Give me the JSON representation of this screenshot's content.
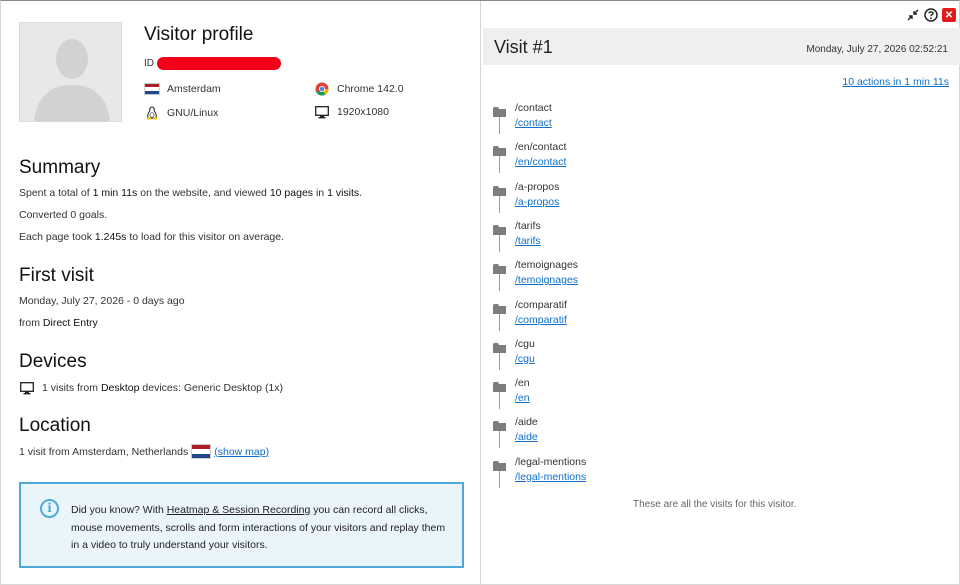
{
  "profile": {
    "title": "Visitor profile",
    "id_label": "ID",
    "city": "Amsterdam",
    "os": "GNU/Linux",
    "browser": "Chrome 142.0",
    "resolution": "1920x1080",
    "flag_colors": [
      "#ae1c28",
      "#ffffff",
      "#21468b"
    ]
  },
  "summary": {
    "heading": "Summary",
    "line1_a": "Spent a total of ",
    "line1_b": "1 min 11s",
    "line1_c": " on the website, and viewed ",
    "line1_d": "10 pages",
    "line1_e": " in ",
    "line1_f": "1 visits",
    "line1_g": ".",
    "line2": "Converted 0 goals.",
    "line3_a": "Each page took ",
    "line3_b": "1.245s",
    "line3_c": " to load for this visitor on average."
  },
  "first_visit": {
    "heading": "First visit",
    "date": "Monday, July 27, 2026 - 0 days ago",
    "from_a": "from ",
    "from_b": "Direct Entry"
  },
  "devices": {
    "heading": "Devices",
    "line_a": "1 visits from ",
    "line_b": "Desktop",
    "line_c": " devices: Generic Desktop (1x)"
  },
  "location": {
    "heading": "Location",
    "text": "1 visit from Amsterdam, Netherlands",
    "show_map": "(show map)"
  },
  "info": {
    "text_a": "Did you know? With ",
    "link": "Heatmap & Session Recording",
    "text_b": " you can record all clicks, mouse movements, scrolls and form interactions of your visitors and replay them in a video to truly understand your visitors."
  },
  "visit": {
    "title": "Visit #1",
    "date": "Monday, July 27, 2026 02:52:21",
    "actions_link": "10 actions in 1 min 11s",
    "actions": [
      {
        "title": "/contact",
        "url": "/contact"
      },
      {
        "title": "/en/contact",
        "url": "/en/contact"
      },
      {
        "title": "/a-propos",
        "url": "/a-propos"
      },
      {
        "title": "/tarifs",
        "url": "/tarifs"
      },
      {
        "title": "/temoignages",
        "url": "/temoignages"
      },
      {
        "title": "/comparatif",
        "url": "/comparatif"
      },
      {
        "title": "/cgu",
        "url": "/cgu"
      },
      {
        "title": "/en",
        "url": "/en"
      },
      {
        "title": "/aide",
        "url": "/aide"
      },
      {
        "title": "/legal-mentions",
        "url": "/legal-mentions"
      }
    ],
    "end_text": "These are all the visits for this visitor."
  },
  "toolbar": {
    "icons": [
      "minimize-icon",
      "help-icon",
      "close-icon"
    ]
  }
}
